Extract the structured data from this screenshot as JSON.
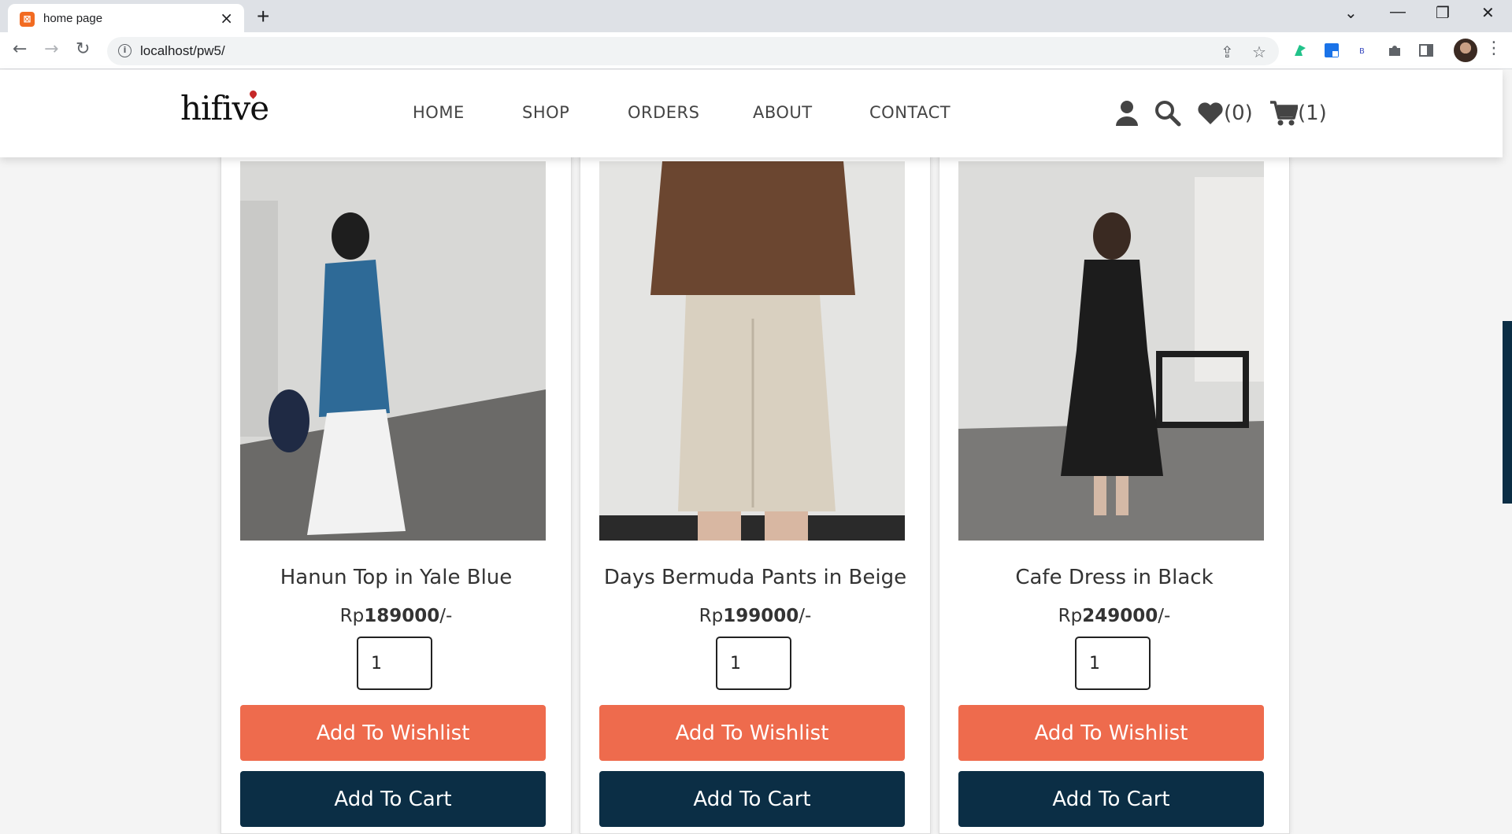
{
  "browser": {
    "tab_title": "home page",
    "url": "localhost/pw5/"
  },
  "site": {
    "logo": "hifive",
    "nav": [
      "HOME",
      "SHOP",
      "ORDERS",
      "ABOUT",
      "CONTACT"
    ],
    "wishlist_count": "(0)",
    "cart_count": "(1)"
  },
  "products": [
    {
      "name": "Hanun Top in Yale Blue",
      "currency": "Rp",
      "price": "189000",
      "suffix": "/-",
      "quantity": "1",
      "wishlist_label": "Add To Wishlist",
      "cart_label": "Add To Cart"
    },
    {
      "name": "Days Bermuda Pants in Beige",
      "currency": "Rp",
      "price": "199000",
      "suffix": "/-",
      "quantity": "1",
      "wishlist_label": "Add To Wishlist",
      "cart_label": "Add To Cart"
    },
    {
      "name": "Cafe Dress in Black",
      "currency": "Rp",
      "price": "249000",
      "suffix": "/-",
      "quantity": "1",
      "wishlist_label": "Add To Wishlist",
      "cart_label": "Add To Cart"
    }
  ],
  "colors": {
    "wishlist_button": "#ee6b4d",
    "cart_button": "#0b2e45"
  }
}
